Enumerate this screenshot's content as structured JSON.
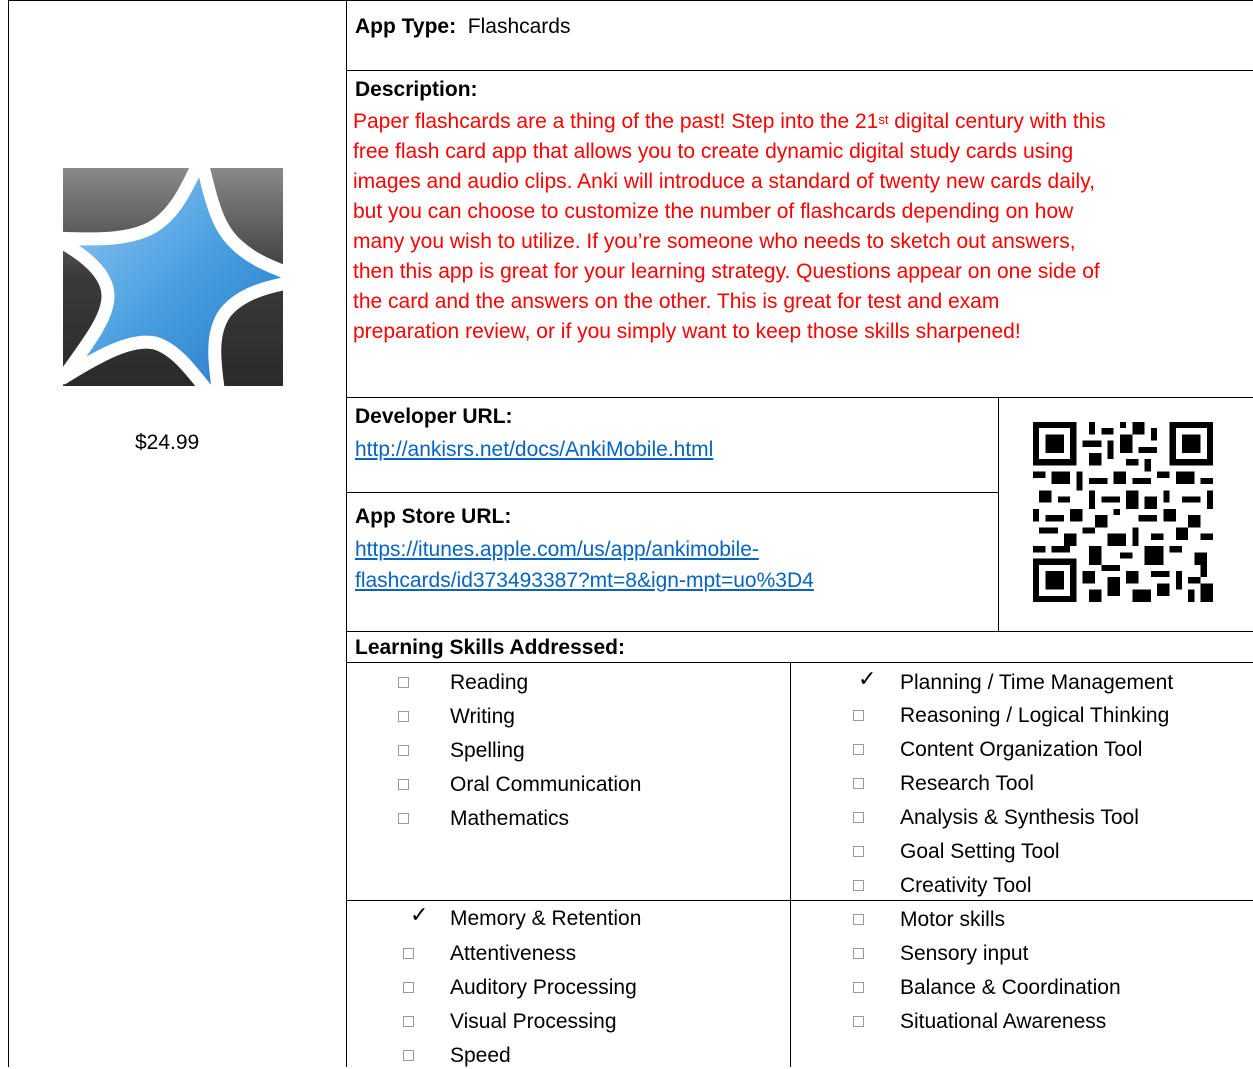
{
  "price": "$24.99",
  "app_type": {
    "label": "App Type:",
    "value": "Flashcards"
  },
  "description": {
    "label": "Description:",
    "line1_pre": "Paper flashcards are a thing of the past! Step into the 21",
    "line1_sup": "st",
    "line1_post": " digital century with this",
    "line2": "free flash card app that allows you to create dynamic digital study cards using",
    "line3": "images and audio clips. Anki will introduce a standard of twenty new cards daily,",
    "line4": "but you can choose to customize the number of flashcards depending on how",
    "line5": "many you wish to utilize. If you’re someone who needs to sketch out answers,",
    "line6": "then this app is great for your learning strategy. Questions appear on one side of",
    "line7": "the card and the answers on the other. This is great for test and exam",
    "line8": "preparation review, or if you simply want to keep those skills sharpened!"
  },
  "developer": {
    "label": "Developer URL:",
    "url": "http://ankisrs.net/docs/AnkiMobile.html"
  },
  "app_store": {
    "label": "App Store URL:",
    "url_line1": "https://itunes.apple.com/us/app/ankimobile-",
    "url_line2": "flashcards/id373493387?mt=8&ign-mpt=uo%3D4"
  },
  "skills": {
    "label": "Learning Skills Addressed:",
    "col1": [
      {
        "label": "Reading",
        "checked": false
      },
      {
        "label": "Writing",
        "checked": false
      },
      {
        "label": "Spelling",
        "checked": false
      },
      {
        "label": "Oral Communication",
        "checked": false
      },
      {
        "label": "Mathematics",
        "checked": false
      }
    ],
    "col2": [
      {
        "label": "Planning / Time Management",
        "checked": true
      },
      {
        "label": "Reasoning / Logical Thinking",
        "checked": false
      },
      {
        "label": "Content Organization Tool",
        "checked": false
      },
      {
        "label": "Research Tool",
        "checked": false
      },
      {
        "label": "Analysis & Synthesis Tool",
        "checked": false
      },
      {
        "label": "Goal Setting Tool",
        "checked": false
      },
      {
        "label": "Creativity Tool",
        "checked": false
      }
    ],
    "col3": [
      {
        "label": "Memory & Retention",
        "checked": true
      },
      {
        "label": "Attentiveness",
        "checked": false
      },
      {
        "label": "Auditory Processing",
        "checked": false
      },
      {
        "label": "Visual Processing",
        "checked": false
      },
      {
        "label": "Speed",
        "checked": false
      }
    ],
    "col4": [
      {
        "label": "Motor skills",
        "checked": false
      },
      {
        "label": "Sensory input",
        "checked": false
      },
      {
        "label": "Balance & Coordination",
        "checked": false
      },
      {
        "label": "Situational Awareness",
        "checked": false
      }
    ]
  },
  "colors": {
    "description_text": "#ff0000",
    "link": "#0563c1",
    "logo_blue": "#3a8fd8"
  },
  "icons": {
    "logo": "anki-star-logo",
    "qr": "qr-code"
  }
}
